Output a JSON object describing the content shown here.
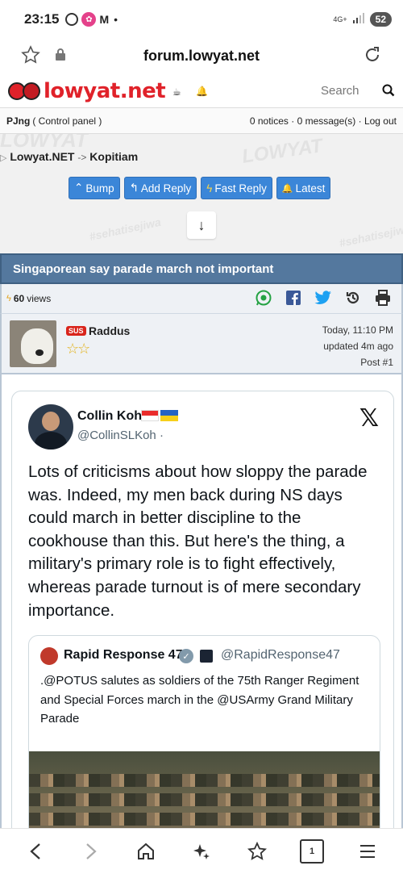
{
  "status_bar": {
    "time": "23:15",
    "network": "4G+",
    "battery": "52"
  },
  "browser": {
    "url": "forum.lowyat.net"
  },
  "site": {
    "logo_text": "lowyat.net",
    "search_placeholder": "Search"
  },
  "user_bar": {
    "username": "PJng",
    "control_panel": "( Control panel )",
    "notices": "0 notices",
    "messages": "0 message(s)",
    "logout": "Log out",
    "separator": "·"
  },
  "breadcrumb": {
    "root": "Lowyat.NET",
    "separator": "->",
    "current": "Kopitiam"
  },
  "banner": {
    "watermark_1": "LOWYAT",
    "watermark_2": "#sehatisejiwa"
  },
  "actions": {
    "bump": "Bump",
    "add_reply": "Add Reply",
    "fast_reply": "Fast Reply",
    "latest": "Latest"
  },
  "topic": {
    "title": "Singaporean say parade march not important",
    "views_count": "60",
    "views_label": "views"
  },
  "post": {
    "badge": "SUS",
    "author": "Raddus",
    "time": "Today, 11:10 PM",
    "updated": "updated 4m ago",
    "post_number": "Post #1"
  },
  "tweet": {
    "name": "Collin Koh",
    "handle": "@CollinSLKoh ·",
    "text": "Lots of criticisms about how sloppy the parade was. Indeed, my men back during NS days could march in better discipline to the cookhouse than this. But here's the thing, a military's primary role is to fight effectively, whereas parade turnout is of mere secondary importance.",
    "quote": {
      "name": "Rapid Response 47",
      "handle": "@RapidResponse47",
      "text": ".@POTUS salutes as soldiers of the 75th Ranger Regiment and Special Forces march in the @USArmy Grand Military Parade"
    }
  },
  "bottom_nav": {
    "tab_count": "1"
  },
  "colors": {
    "accent": "#3b86d8",
    "brand_red": "#e0222a",
    "topic_bar": "#54789e"
  }
}
